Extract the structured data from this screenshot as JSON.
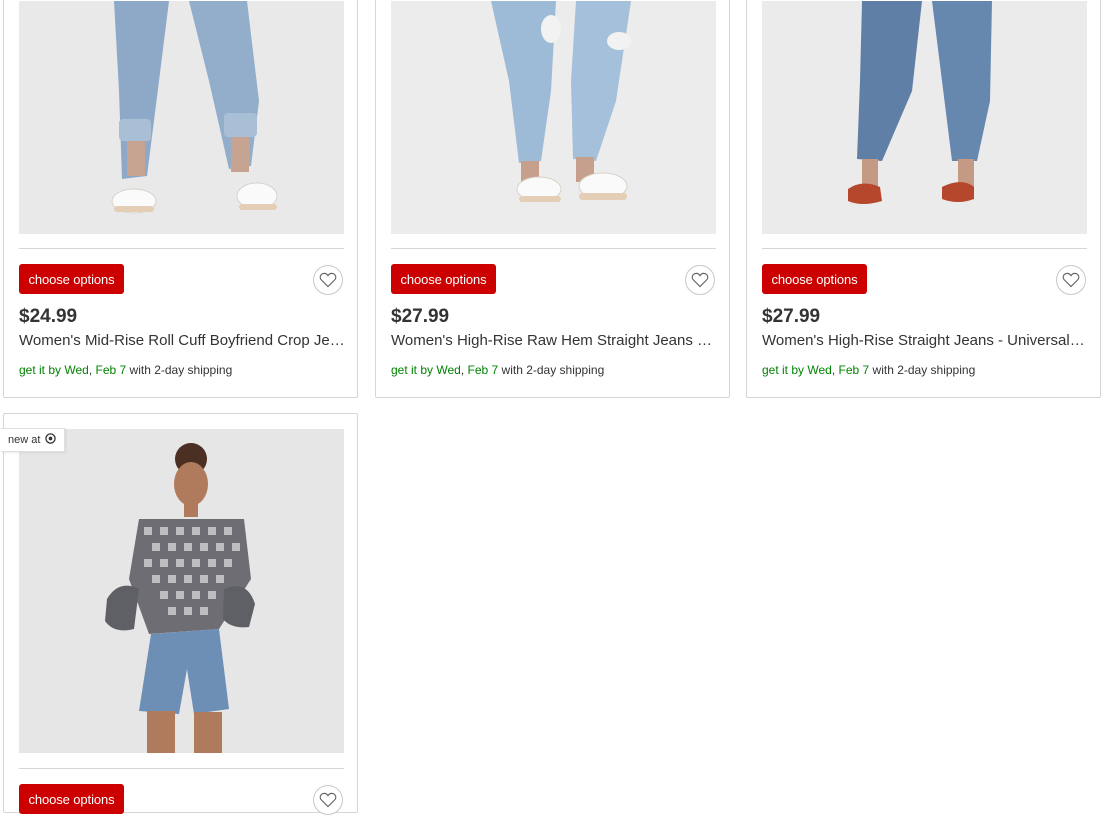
{
  "products": [
    {
      "price": "$24.99",
      "title": "Women's Mid-Rise Roll Cuff Boyfriend Crop Jeans",
      "button": "choose options",
      "shipping_prefix": "get it by ",
      "shipping_day": "Wed",
      "shipping_sep": ", ",
      "shipping_date": "Feb 7",
      "shipping_suffix": " with 2-day shipping"
    },
    {
      "price": "$27.99",
      "title": "Women's High-Rise Raw Hem Straight Jeans - Universal Thread",
      "button": "choose options",
      "shipping_prefix": "get it by ",
      "shipping_day": "Wed",
      "shipping_sep": ", ",
      "shipping_date": "Feb 7",
      "shipping_suffix": " with 2-day shipping"
    },
    {
      "price": "$27.99",
      "title": "Women's High-Rise Straight Jeans - Universal Thread",
      "button": "choose options",
      "shipping_prefix": "get it by ",
      "shipping_day": "Wed",
      "shipping_sep": ", ",
      "shipping_date": "Feb 7",
      "shipping_suffix": " with 2-day shipping"
    },
    {
      "badge": "new at",
      "button": "choose options"
    }
  ],
  "icons": {
    "favorite": "heart-outline-icon",
    "badge": "target-bullseye-icon"
  },
  "colors": {
    "accent_red": "#cc0000",
    "shipping_green": "#008300",
    "image_bg": "#e9e9e9"
  }
}
